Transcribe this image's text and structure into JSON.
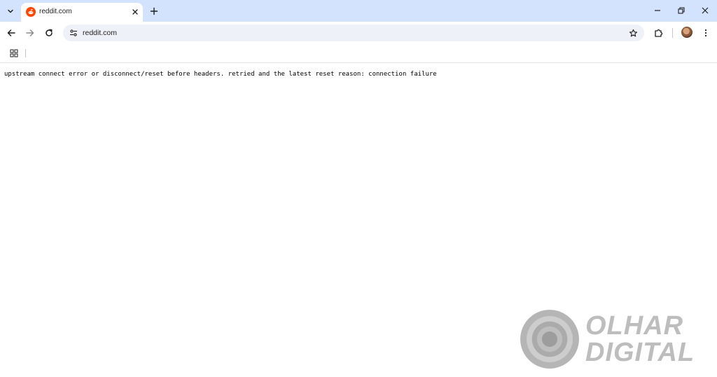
{
  "browser": {
    "tab": {
      "title": "reddit.com",
      "favicon": "reddit-icon"
    },
    "address_bar": {
      "url": "reddit.com"
    },
    "icons": {
      "tab_search": "chevron-down-icon",
      "tab_close": "close-icon",
      "new_tab": "plus-icon",
      "minimize": "minimize-icon",
      "restore": "restore-icon",
      "close_window": "close-icon",
      "back": "arrow-left-icon",
      "forward": "arrow-right-icon",
      "reload": "reload-icon",
      "site_info": "tune-icon",
      "bookmark": "star-icon",
      "extensions": "puzzle-icon",
      "profile": "avatar",
      "menu": "kebab-menu-icon",
      "apps": "apps-grid-icon"
    },
    "colors": {
      "titlebar": "#d3e3fd",
      "omnibox": "#eef1f7",
      "reddit_orange": "#ff4500"
    }
  },
  "page": {
    "error_message": "upstream connect error or disconnect/reset before headers. retried and the latest reset reason: connection failure"
  },
  "watermark": {
    "line1": "OLHAR",
    "line2": "DIGITAL"
  }
}
